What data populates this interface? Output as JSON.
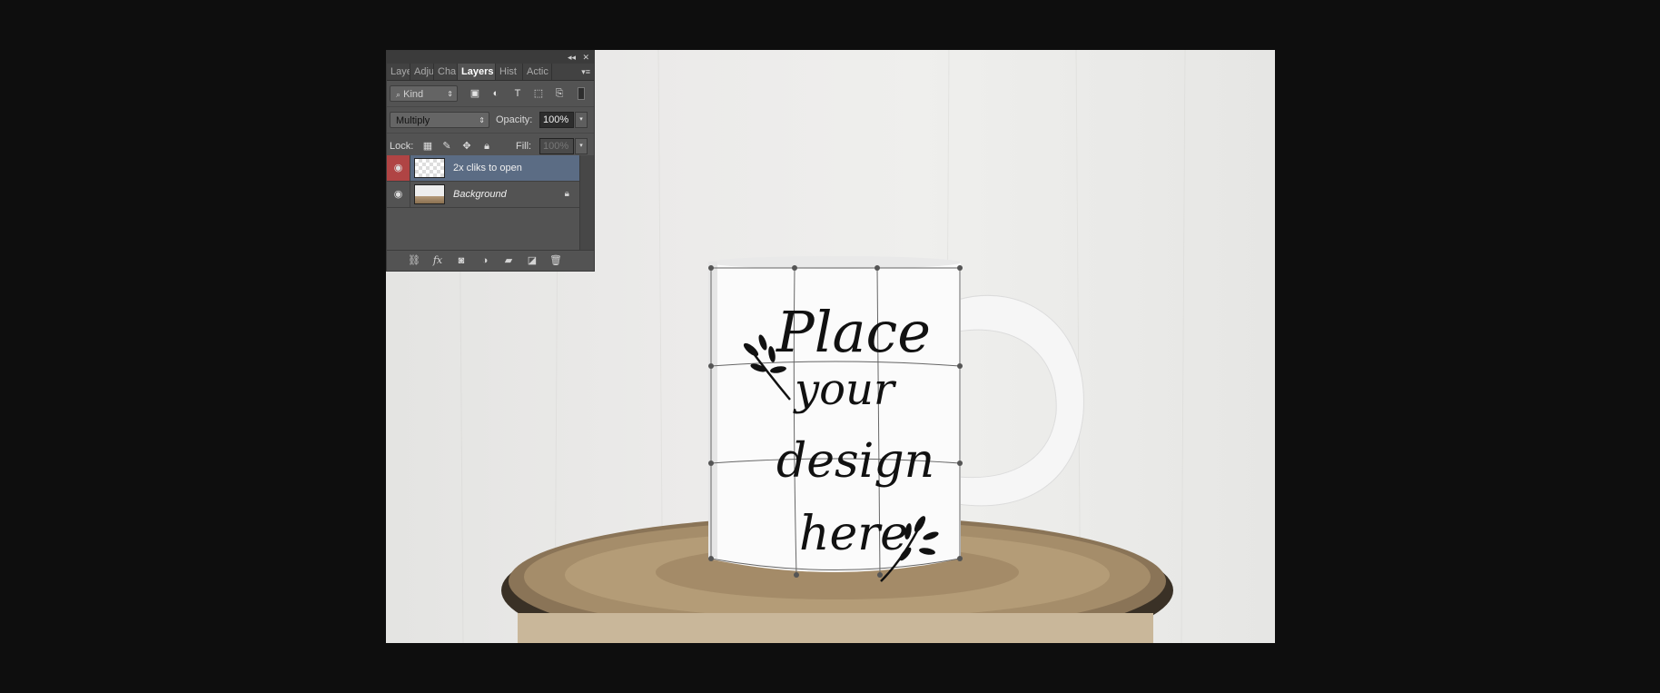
{
  "panel": {
    "controls": {
      "collapse": "◂◂",
      "close": "✕"
    },
    "tabs": [
      "Layers",
      "Adjustments",
      "Channels",
      "Layers",
      "History",
      "Actions"
    ],
    "tabs_display": [
      "Laye",
      "Adju",
      "Cha",
      "Layers",
      "Hist",
      "Actic"
    ],
    "tab_menu": "▾≡",
    "filter": {
      "kind_label": "Kind"
    },
    "blend_mode": "Multiply",
    "opacity_label": "Opacity:",
    "opacity_value": "100%",
    "lock_label": "Lock:",
    "fill_label": "Fill:",
    "fill_value": "100%",
    "layers": [
      {
        "name": "2x cliks to open",
        "active": true
      },
      {
        "name": "Background",
        "active": false
      }
    ]
  },
  "canvas": {
    "mug_text": [
      "Place",
      "your",
      "design",
      "here"
    ]
  }
}
